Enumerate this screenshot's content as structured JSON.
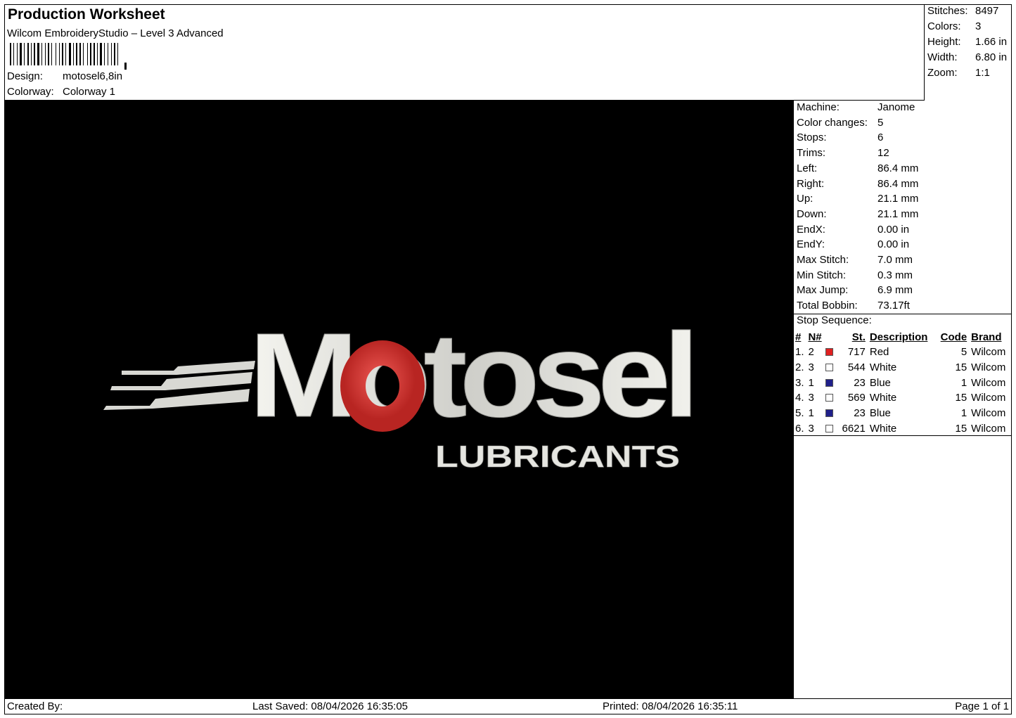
{
  "header": {
    "title": "Production Worksheet",
    "subtitle": "Wilcom EmbroideryStudio – Level 3 Advanced",
    "design_label": "Design:",
    "design_value": "motosel6,8in",
    "colorway_label": "Colorway:",
    "colorway_value": "Colorway 1"
  },
  "summary": [
    {
      "label": "Stitches:",
      "value": "8497"
    },
    {
      "label": "Colors:",
      "value": "3"
    },
    {
      "label": "Height:",
      "value": "1.66 in"
    },
    {
      "label": "Width:",
      "value": "6.80 in"
    },
    {
      "label": "Zoom:",
      "value": "1:1"
    }
  ],
  "artwork": {
    "main_text": "Motosel",
    "sub_text": "LUBRICANTS",
    "background_color": "#000000",
    "thread_white": "#e9e9e4",
    "thread_red": "#d9322f"
  },
  "machine": [
    {
      "label": "Machine:",
      "value": "Janome"
    },
    {
      "label": "Color changes:",
      "value": "5"
    },
    {
      "label": "Stops:",
      "value": "6"
    },
    {
      "label": "Trims:",
      "value": "12"
    },
    {
      "label": "Left:",
      "value": "86.4 mm"
    },
    {
      "label": "Right:",
      "value": "86.4 mm"
    },
    {
      "label": "Up:",
      "value": "21.1 mm"
    },
    {
      "label": "Down:",
      "value": "21.1 mm"
    },
    {
      "label": "EndX:",
      "value": "0.00 in"
    },
    {
      "label": "EndY:",
      "value": "0.00 in"
    },
    {
      "label": "Max Stitch:",
      "value": "7.0 mm"
    },
    {
      "label": "Min Stitch:",
      "value": "0.3 mm"
    },
    {
      "label": "Max Jump:",
      "value": "6.9 mm"
    },
    {
      "label": "Total Bobbin:",
      "value": "73.17ft"
    }
  ],
  "stop_sequence": {
    "title": "Stop Sequence:",
    "headers": {
      "idx": "#",
      "n": "N#",
      "st": "St.",
      "desc": "Description",
      "code": "Code",
      "brand": "Brand"
    },
    "rows": [
      {
        "idx": "1.",
        "n": "2",
        "color": "#e02020",
        "st": "717",
        "desc": "Red",
        "code": "5",
        "brand": "Wilcom"
      },
      {
        "idx": "2.",
        "n": "3",
        "color": "#ffffff",
        "st": "544",
        "desc": "White",
        "code": "15",
        "brand": "Wilcom"
      },
      {
        "idx": "3.",
        "n": "1",
        "color": "#1f1f8a",
        "st": "23",
        "desc": "Blue",
        "code": "1",
        "brand": "Wilcom"
      },
      {
        "idx": "4.",
        "n": "3",
        "color": "#ffffff",
        "st": "569",
        "desc": "White",
        "code": "15",
        "brand": "Wilcom"
      },
      {
        "idx": "5.",
        "n": "1",
        "color": "#1f1f8a",
        "st": "23",
        "desc": "Blue",
        "code": "1",
        "brand": "Wilcom"
      },
      {
        "idx": "6.",
        "n": "3",
        "color": "#ffffff",
        "st": "6621",
        "desc": "White",
        "code": "15",
        "brand": "Wilcom"
      }
    ]
  },
  "footer": {
    "created_by": "Created By:",
    "last_saved": "Last Saved: 08/04/2026 16:35:05",
    "printed": "Printed: 08/04/2026 16:35:11",
    "page": "Page 1 of 1"
  }
}
